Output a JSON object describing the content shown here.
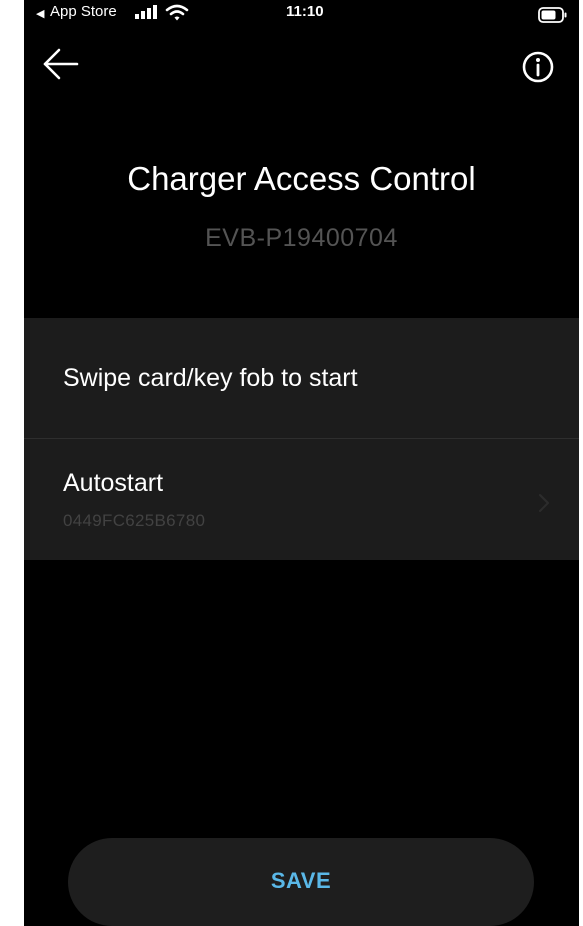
{
  "status_bar": {
    "back_app": "App Store",
    "time": "11:10"
  },
  "nav": {
    "back_icon": "arrow-left-icon",
    "info_icon": "info-circle-icon"
  },
  "header": {
    "title": "Charger Access Control",
    "device_id": "EVB-P19400704"
  },
  "options": [
    {
      "title": "Swipe card/key fob to start"
    },
    {
      "title": "Autostart",
      "subtitle": "0449FC625B6780",
      "icon": "chevron-right-icon"
    }
  ],
  "footer": {
    "save_label": "SAVE"
  },
  "colors": {
    "background": "#000000",
    "row_background": "#1c1c1c",
    "accent": "#5ab8e8",
    "muted_text": "#545454"
  }
}
